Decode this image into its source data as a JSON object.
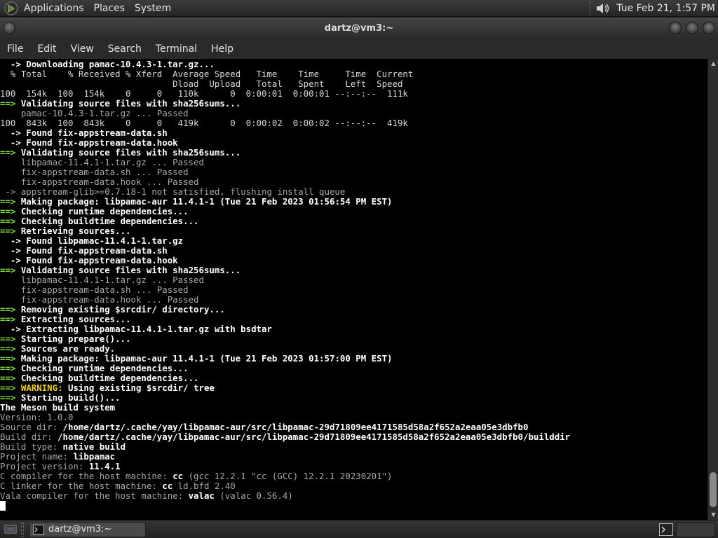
{
  "top_panel": {
    "menus": [
      "Applications",
      "Places",
      "System"
    ],
    "clock": "Tue Feb 21,  1:57 PM"
  },
  "window": {
    "title": "dartz@vm3:~",
    "menu": [
      "File",
      "Edit",
      "View",
      "Search",
      "Terminal",
      "Help"
    ]
  },
  "terminal": {
    "lines": [
      [
        [
          "  -> Downloading pamac-10.4.3-1.tar.gz...",
          "b"
        ]
      ],
      [
        [
          "  % Total    % Received % Xferd  Average Speed   Time    Time     Time  Current",
          ""
        ]
      ],
      [
        [
          "                                 Dload  Upload   Total   Spent    Left  Speed",
          ""
        ]
      ],
      [
        [
          "100  154k  100  154k    0     0   110k      0  0:00:01  0:00:01 --:--:--  111k",
          ""
        ]
      ],
      [
        [
          "==>",
          "g"
        ],
        [
          " Validating source files with sha256sums...",
          "b"
        ]
      ],
      [
        [
          "    pamac-10.4.3-1.tar.gz ... Passed",
          "d"
        ]
      ],
      [
        [
          "100  843k  100  843k    0     0   419k      0  0:00:02  0:00:02 --:--:--  419k",
          ""
        ]
      ],
      [
        [
          "  -> Found fix-appstream-data.sh",
          "b"
        ]
      ],
      [
        [
          "  -> Found fix-appstream-data.hook",
          "b"
        ]
      ],
      [
        [
          "==>",
          "g"
        ],
        [
          " Validating source files with sha256sums...",
          "b"
        ]
      ],
      [
        [
          "    libpamac-11.4.1-1.tar.gz ... Passed",
          "d"
        ]
      ],
      [
        [
          "    fix-appstream-data.sh ... Passed",
          "d"
        ]
      ],
      [
        [
          "    fix-appstream-data.hook ... Passed",
          "d"
        ]
      ],
      [
        [
          " -> appstream-glib>=0.7.18-1 not satisfied, flushing install queue",
          "d"
        ]
      ],
      [
        [
          "==>",
          "g"
        ],
        [
          " Making package: libpamac-aur 11.4.1-1 (Tue 21 Feb 2023 01:56:54 PM EST)",
          "b"
        ]
      ],
      [
        [
          "==>",
          "g"
        ],
        [
          " Checking runtime dependencies...",
          "b"
        ]
      ],
      [
        [
          "==>",
          "g"
        ],
        [
          " Checking buildtime dependencies...",
          "b"
        ]
      ],
      [
        [
          "==>",
          "g"
        ],
        [
          " Retrieving sources...",
          "b"
        ]
      ],
      [
        [
          "  -> Found libpamac-11.4.1-1.tar.gz",
          "b"
        ]
      ],
      [
        [
          "  -> Found fix-appstream-data.sh",
          "b"
        ]
      ],
      [
        [
          "  -> Found fix-appstream-data.hook",
          "b"
        ]
      ],
      [
        [
          "==>",
          "g"
        ],
        [
          " Validating source files with sha256sums...",
          "b"
        ]
      ],
      [
        [
          "    libpamac-11.4.1-1.tar.gz ... Passed",
          "d"
        ]
      ],
      [
        [
          "    fix-appstream-data.sh ... Passed",
          "d"
        ]
      ],
      [
        [
          "    fix-appstream-data.hook ... Passed",
          "d"
        ]
      ],
      [
        [
          "==>",
          "g"
        ],
        [
          " Removing existing $srcdir/ directory...",
          "b"
        ]
      ],
      [
        [
          "==>",
          "g"
        ],
        [
          " Extracting sources...",
          "b"
        ]
      ],
      [
        [
          "  -> Extracting libpamac-11.4.1-1.tar.gz with bsdtar",
          "b"
        ]
      ],
      [
        [
          "==>",
          "g"
        ],
        [
          " Starting prepare()...",
          "b"
        ]
      ],
      [
        [
          "==>",
          "g"
        ],
        [
          " Sources are ready.",
          "b"
        ]
      ],
      [
        [
          "==>",
          "g"
        ],
        [
          " Making package: libpamac-aur 11.4.1-1 (Tue 21 Feb 2023 01:57:00 PM EST)",
          "b"
        ]
      ],
      [
        [
          "==>",
          "g"
        ],
        [
          " Checking runtime dependencies...",
          "b"
        ]
      ],
      [
        [
          "==>",
          "g"
        ],
        [
          " Checking buildtime dependencies...",
          "b"
        ]
      ],
      [
        [
          "==>",
          "g"
        ],
        [
          " ",
          "b"
        ],
        [
          "WARNING:",
          "y"
        ],
        [
          " Using existing $srcdir/ tree",
          "b"
        ]
      ],
      [
        [
          "==>",
          "g"
        ],
        [
          " Starting build()...",
          "b"
        ]
      ],
      [
        [
          "The Meson build system",
          "b"
        ]
      ],
      [
        [
          "Version: 1.0.0",
          "d"
        ]
      ],
      [
        [
          "Source dir: ",
          "d"
        ],
        [
          "/home/dartz/.cache/yay/libpamac-aur/src/libpamac-29d71809ee4171585d58a2f652a2eaa05e3dbfb0",
          "b"
        ]
      ],
      [
        [
          "Build dir: ",
          "d"
        ],
        [
          "/home/dartz/.cache/yay/libpamac-aur/src/libpamac-29d71809ee4171585d58a2f652a2eaa05e3dbfb0/builddir",
          "b"
        ]
      ],
      [
        [
          "Build type: ",
          "d"
        ],
        [
          "native build",
          "b"
        ]
      ],
      [
        [
          "Project name: ",
          "d"
        ],
        [
          "libpamac",
          "b"
        ]
      ],
      [
        [
          "Project version: ",
          "d"
        ],
        [
          "11.4.1",
          "b"
        ]
      ],
      [
        [
          "C compiler for the host machine: ",
          "d"
        ],
        [
          "cc",
          "b"
        ],
        [
          " (gcc 12.2.1 \"cc (GCC) 12.2.1 20230201\")",
          "d"
        ]
      ],
      [
        [
          "C linker for the host machine: ",
          "d"
        ],
        [
          "cc",
          "b"
        ],
        [
          " ld.bfd 2.40",
          "d"
        ]
      ],
      [
        [
          "Vala compiler for the host machine: ",
          "d"
        ],
        [
          "valac",
          "b"
        ],
        [
          " (valac 0.56.4)",
          "d"
        ]
      ]
    ]
  },
  "taskbar": {
    "item_label": "dartz@vm3:~"
  }
}
